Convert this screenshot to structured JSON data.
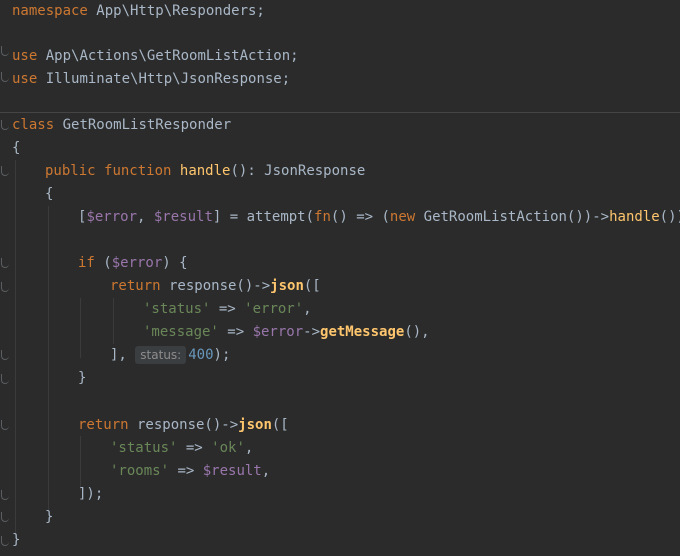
{
  "code": {
    "line1": {
      "kw": "namespace",
      "text": " App\\Http\\Responders;"
    },
    "line3": {
      "kw": "use",
      "text": " App\\Actions\\GetRoomListAction;"
    },
    "line4": {
      "kw": "use",
      "text": " Illuminate\\Http\\JsonResponse;"
    },
    "line6": {
      "kw": "class",
      "text": " GetRoomListResponder"
    },
    "line7": {
      "text": "{"
    },
    "line8": {
      "kw1": "public",
      "kw2": "function",
      "fn": "handle",
      "text": "(): JsonResponse"
    },
    "line9": {
      "text": "{"
    },
    "line10": {
      "a": "[",
      "v1": "$error",
      "b": ", ",
      "v2": "$result",
      "c": "] = attempt(",
      "fnkw": "fn",
      "d": "() => (",
      "newkw": "new",
      "e": " GetRoomListAction())->",
      "fn": "handle",
      "f": "());"
    },
    "line12": {
      "kw": "if",
      "a": " (",
      "v": "$error",
      "b": ") {"
    },
    "line13": {
      "kw": "return",
      "a": " response()->",
      "fn": "json",
      "b": "(["
    },
    "line14": {
      "s1": "'status'",
      "a": " => ",
      "s2": "'error'",
      "b": ","
    },
    "line15": {
      "s1": "'message'",
      "a": " => ",
      "v": "$error",
      "b": "->",
      "fn": "getMessage",
      "c": "(),"
    },
    "line16": {
      "a": "], ",
      "hint": "status:",
      "num": "400",
      "b": ");"
    },
    "line17": {
      "text": "}"
    },
    "line19": {
      "kw": "return",
      "a": " response()->",
      "fn": "json",
      "b": "(["
    },
    "line20": {
      "s1": "'status'",
      "a": " => ",
      "s2": "'ok'",
      "b": ","
    },
    "line21": {
      "s1": "'rooms'",
      "a": " => ",
      "v": "$result",
      "b": ","
    },
    "line22": {
      "text": "]);"
    },
    "line23": {
      "text": "}"
    },
    "line24": {
      "text": "}"
    }
  },
  "colors": {
    "background": "#2b2b2b",
    "keyword": "#cc7832",
    "function": "#ffc66d",
    "variable": "#9876aa",
    "string": "#6a8759",
    "number": "#6897bb",
    "text": "#a9b7c6"
  }
}
